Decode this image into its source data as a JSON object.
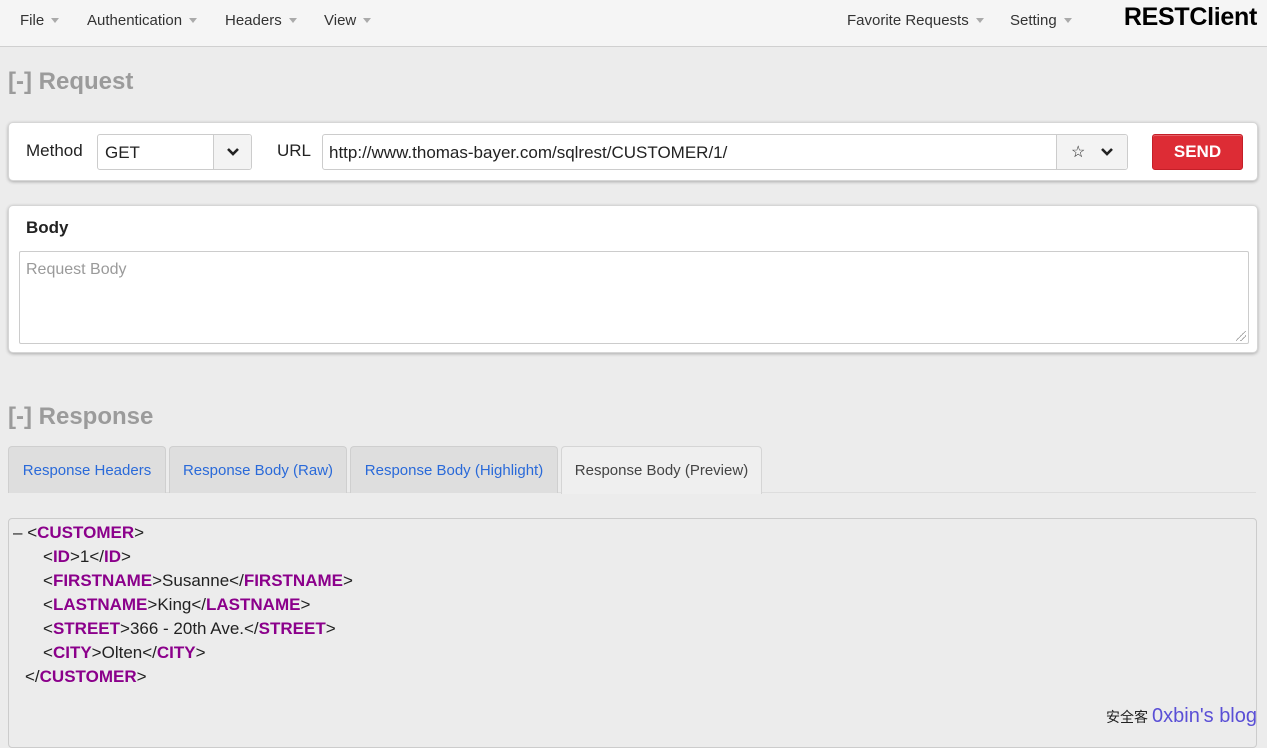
{
  "navbar": {
    "menus": [
      "File",
      "Authentication",
      "Headers",
      "View"
    ],
    "right_menus": [
      "Favorite Requests",
      "Setting"
    ],
    "brand": "RESTClient"
  },
  "request": {
    "title": "[-] Request",
    "method_label": "Method",
    "method_value": "GET",
    "url_label": "URL",
    "url_value": "http://www.thomas-bayer.com/sqlrest/CUSTOMER/1/",
    "send_label": "SEND",
    "body_title": "Body",
    "body_placeholder": "Request Body",
    "icons": {
      "favorite": "star-icon",
      "dropdown": "chevron-down-icon"
    }
  },
  "response": {
    "title": "[-] Response",
    "tabs": [
      {
        "label": "Response Headers",
        "active": false
      },
      {
        "label": "Response Body (Raw)",
        "active": false
      },
      {
        "label": "Response Body (Highlight)",
        "active": false
      },
      {
        "label": "Response Body (Preview)",
        "active": true
      }
    ],
    "xml": {
      "collapse_marker": "–",
      "root": "CUSTOMER",
      "fields": [
        {
          "tag": "ID",
          "value": "1"
        },
        {
          "tag": "FIRSTNAME",
          "value": "Susanne"
        },
        {
          "tag": "LASTNAME",
          "value": "King"
        },
        {
          "tag": "STREET",
          "value": "366 - 20th Ave."
        },
        {
          "tag": "CITY",
          "value": "Olten"
        }
      ]
    }
  },
  "watermark": {
    "small": "安全客",
    "big": "0xbin's blog"
  },
  "colors": {
    "send": "#dd2c35",
    "tab_link": "#2a6ad9",
    "xml_tag": "#8b008b",
    "section_title": "#9b9b9b"
  }
}
